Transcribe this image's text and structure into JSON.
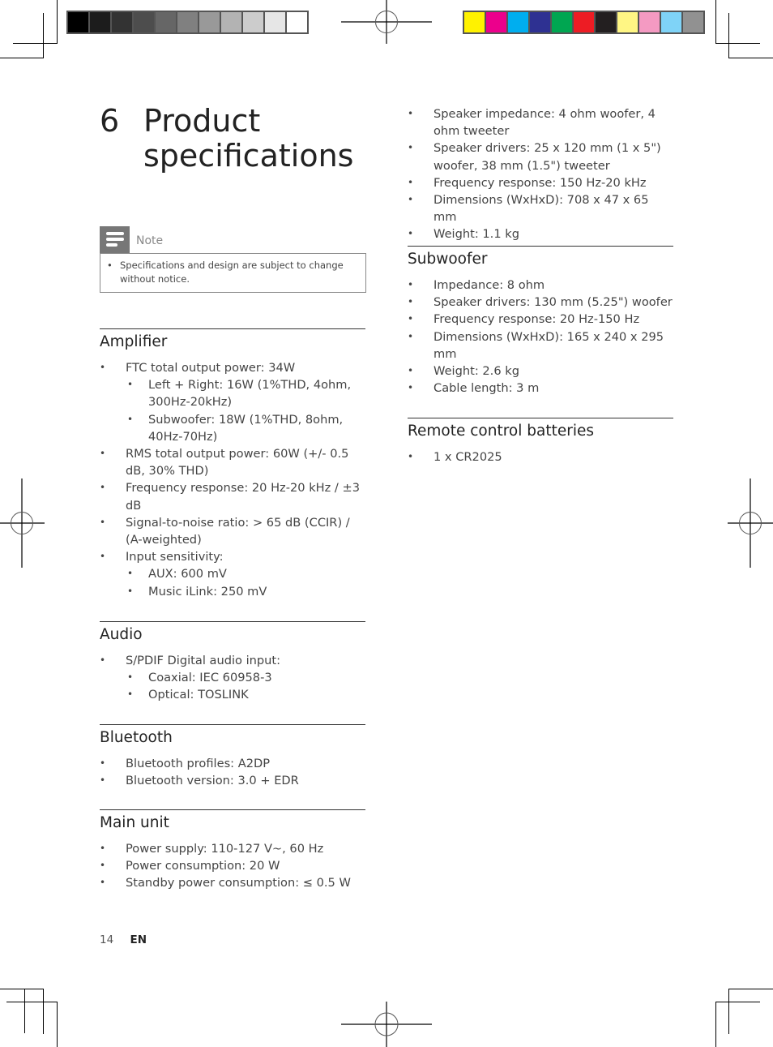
{
  "print_marks": {
    "grayscale_swatches": [
      "#000000",
      "#1c1c1c",
      "#333333",
      "#4d4d4d",
      "#666666",
      "#808080",
      "#999999",
      "#b3b3b3",
      "#cccccc",
      "#e6e6e6",
      "#ffffff"
    ],
    "color_swatches": [
      "#fff200",
      "#ec008c",
      "#00aeef",
      "#2e3192",
      "#00a651",
      "#ed1c24",
      "#231f20",
      "#fff684",
      "#f49ac2",
      "#7fd3f7",
      "#919191"
    ]
  },
  "chapter": {
    "number": "6",
    "title_line1": "Product",
    "title_line2": "specifications"
  },
  "note": {
    "label": "Note",
    "items": [
      "Specifications and design are subject to change without notice."
    ]
  },
  "sections": {
    "amplifier": {
      "heading": "Amplifier",
      "items": [
        {
          "text": "FTC total output power: 34W",
          "level": 1
        },
        {
          "text": "Left + Right: 16W (1%THD, 4ohm, 300Hz-20kHz)",
          "level": 2
        },
        {
          "text": "Subwoofer: 18W (1%THD, 8ohm, 40Hz-70Hz)",
          "level": 2
        },
        {
          "text": "RMS total output power: 60W (+/- 0.5 dB, 30% THD)",
          "level": 1
        },
        {
          "text": "Frequency response: 20 Hz-20 kHz / ±3 dB",
          "level": 1
        },
        {
          "text": "Signal-to-noise ratio: > 65 dB (CCIR) / (A-weighted)",
          "level": 1
        },
        {
          "text": "Input sensitivity:",
          "level": 1
        },
        {
          "text": "AUX: 600 mV",
          "level": 2
        },
        {
          "text": "Music iLink: 250 mV",
          "level": 2
        }
      ]
    },
    "audio": {
      "heading": "Audio",
      "items": [
        {
          "text": "S/PDIF Digital audio input:",
          "level": 1
        },
        {
          "text": "Coaxial: IEC 60958-3",
          "level": 2
        },
        {
          "text": "Optical: TOSLINK",
          "level": 2
        }
      ]
    },
    "bluetooth": {
      "heading": "Bluetooth",
      "items": [
        {
          "text": "Bluetooth profiles: A2DP",
          "level": 1
        },
        {
          "text": "Bluetooth version: 3.0 + EDR",
          "level": 1
        }
      ]
    },
    "main_unit": {
      "heading": "Main unit",
      "items": [
        {
          "text": "Power supply: 110-127 V~, 60 Hz",
          "level": 1
        },
        {
          "text": "Power consumption: 20 W",
          "level": 1
        },
        {
          "text": "Standby power consumption: ≤ 0.5 W",
          "level": 1
        }
      ]
    },
    "speakers": {
      "items": [
        {
          "text": "Speaker impedance: 4 ohm woofer, 4 ohm tweeter",
          "level": 1
        },
        {
          "text": "Speaker drivers: 25 x 120 mm (1 x 5\") woofer, 38 mm (1.5\") tweeter",
          "level": 1
        },
        {
          "text": "Frequency response: 150 Hz-20 kHz",
          "level": 1
        },
        {
          "text": "Dimensions (WxHxD): 708 x 47 x 65 mm",
          "level": 1
        },
        {
          "text": "Weight: 1.1 kg",
          "level": 1
        }
      ]
    },
    "subwoofer": {
      "heading": "Subwoofer",
      "items": [
        {
          "text": "Impedance: 8 ohm",
          "level": 1
        },
        {
          "text": "Speaker drivers: 130 mm (5.25\") woofer",
          "level": 1
        },
        {
          "text": "Frequency response: 20 Hz-150 Hz",
          "level": 1
        },
        {
          "text": "Dimensions (WxHxD): 165 x 240 x 295 mm",
          "level": 1
        },
        {
          "text": "Weight: 2.6 kg",
          "level": 1
        },
        {
          "text": "Cable length: 3 m",
          "level": 1
        }
      ]
    },
    "remote": {
      "heading": "Remote control batteries",
      "items": [
        {
          "text": "1 x CR2025",
          "level": 1
        }
      ]
    }
  },
  "footer": {
    "page_number": "14",
    "language": "EN"
  }
}
